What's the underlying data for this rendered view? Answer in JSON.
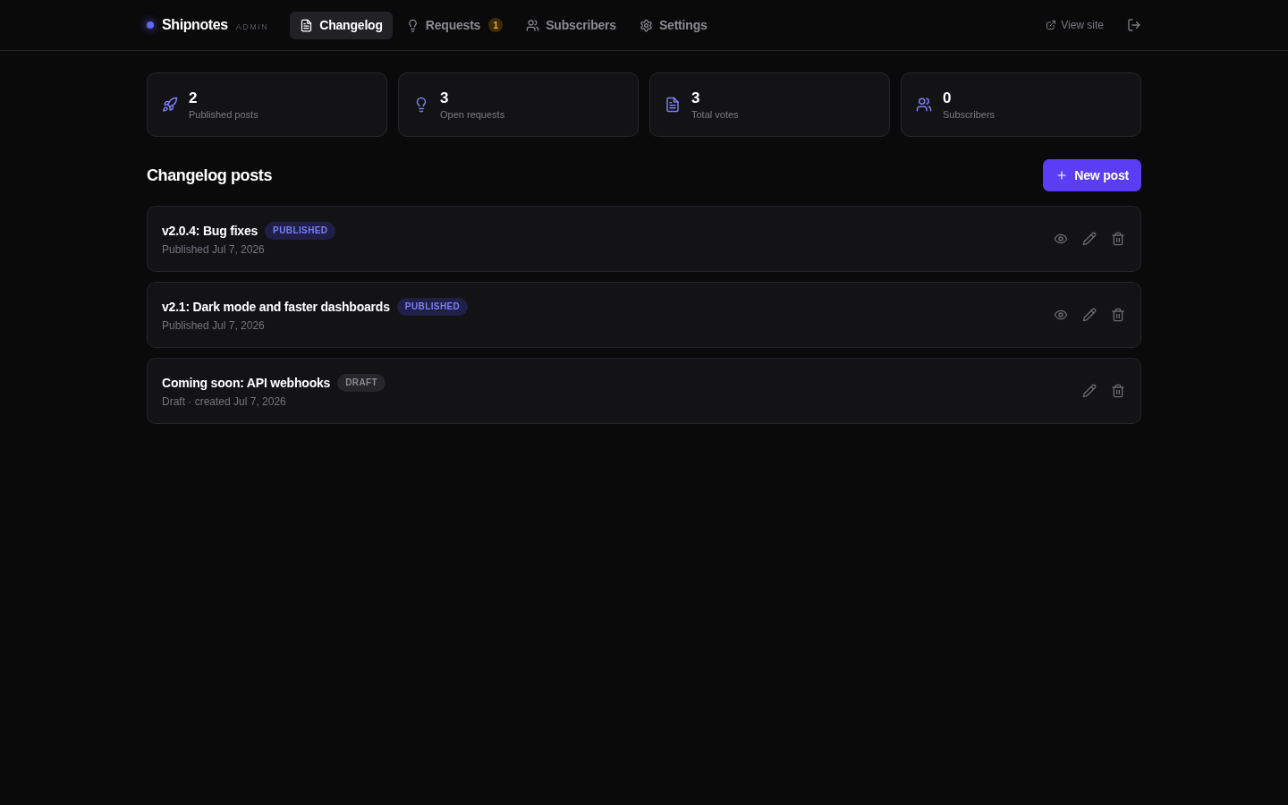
{
  "header": {
    "brand": "Shipnotes",
    "tag": "ADMIN",
    "nav": [
      {
        "label": "Changelog",
        "selected": true
      },
      {
        "label": "Requests",
        "selected": false,
        "badge": "1"
      },
      {
        "label": "Subscribers",
        "selected": false
      },
      {
        "label": "Settings",
        "selected": false
      }
    ],
    "view_site": "View site"
  },
  "stats": [
    {
      "value": "2",
      "label": "Published posts"
    },
    {
      "value": "3",
      "label": "Open requests"
    },
    {
      "value": "3",
      "label": "Total votes"
    },
    {
      "value": "0",
      "label": "Subscribers"
    }
  ],
  "section": {
    "title": "Changelog posts",
    "button": "New post"
  },
  "posts": [
    {
      "title": "v2.0.4: Bug fixes",
      "badge": "PUBLISHED",
      "kind": "published",
      "meta": "Published Jul 7, 2026"
    },
    {
      "title": "v2.1: Dark mode and faster dashboards",
      "badge": "PUBLISHED",
      "kind": "published",
      "meta": "Published Jul 7, 2026"
    },
    {
      "title": "Coming soon: API webhooks",
      "badge": "DRAFT",
      "kind": "draft",
      "meta": "Draft · created Jul 7, 2026"
    }
  ]
}
